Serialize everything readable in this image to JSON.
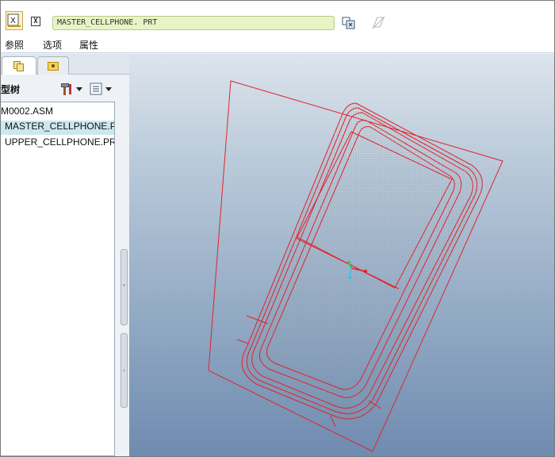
{
  "toolbar": {
    "part_field": "MASTER_CELLPHONE. PRT",
    "icons": [
      "select-model-icon",
      "x-select-icon",
      "insert-pin-icon",
      "disabled-plane-icon"
    ]
  },
  "menu": {
    "items": [
      "参照",
      "选项",
      "属性"
    ]
  },
  "left_panel": {
    "tabs": [
      "model-tree-tab",
      "folder-browser-tab"
    ],
    "tree_title": "型树",
    "tree_items": [
      {
        "label": "M0002.ASM",
        "selected": false
      },
      {
        "label": "MASTER_CELLPHONE.PRT",
        "selected": true
      },
      {
        "label": "UPPER_CELLPHONE.PRT",
        "selected": false
      }
    ],
    "splitter_grips": [
      "˅",
      "◦"
    ]
  },
  "viewport": {
    "model": "cellphone wireframe"
  },
  "colors": {
    "wire": "#e0242a",
    "field_bg": "#e8f4c6",
    "selected_row": "#cce8ee"
  }
}
